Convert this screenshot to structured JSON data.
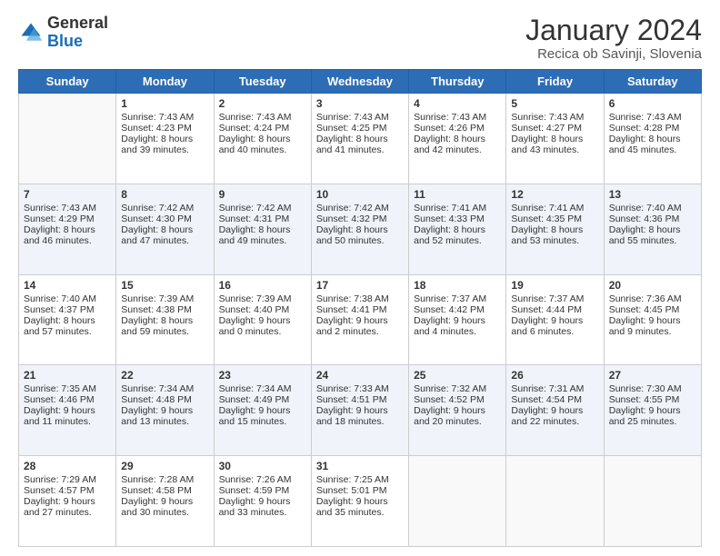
{
  "header": {
    "logo_line1": "General",
    "logo_line2": "Blue",
    "main_title": "January 2024",
    "subtitle": "Recica ob Savinji, Slovenia"
  },
  "days_of_week": [
    "Sunday",
    "Monday",
    "Tuesday",
    "Wednesday",
    "Thursday",
    "Friday",
    "Saturday"
  ],
  "weeks": [
    [
      {
        "day": "",
        "sunrise": "",
        "sunset": "",
        "daylight": ""
      },
      {
        "day": "1",
        "sunrise": "Sunrise: 7:43 AM",
        "sunset": "Sunset: 4:23 PM",
        "daylight": "Daylight: 8 hours and 39 minutes."
      },
      {
        "day": "2",
        "sunrise": "Sunrise: 7:43 AM",
        "sunset": "Sunset: 4:24 PM",
        "daylight": "Daylight: 8 hours and 40 minutes."
      },
      {
        "day": "3",
        "sunrise": "Sunrise: 7:43 AM",
        "sunset": "Sunset: 4:25 PM",
        "daylight": "Daylight: 8 hours and 41 minutes."
      },
      {
        "day": "4",
        "sunrise": "Sunrise: 7:43 AM",
        "sunset": "Sunset: 4:26 PM",
        "daylight": "Daylight: 8 hours and 42 minutes."
      },
      {
        "day": "5",
        "sunrise": "Sunrise: 7:43 AM",
        "sunset": "Sunset: 4:27 PM",
        "daylight": "Daylight: 8 hours and 43 minutes."
      },
      {
        "day": "6",
        "sunrise": "Sunrise: 7:43 AM",
        "sunset": "Sunset: 4:28 PM",
        "daylight": "Daylight: 8 hours and 45 minutes."
      }
    ],
    [
      {
        "day": "7",
        "sunrise": "Sunrise: 7:43 AM",
        "sunset": "Sunset: 4:29 PM",
        "daylight": "Daylight: 8 hours and 46 minutes."
      },
      {
        "day": "8",
        "sunrise": "Sunrise: 7:42 AM",
        "sunset": "Sunset: 4:30 PM",
        "daylight": "Daylight: 8 hours and 47 minutes."
      },
      {
        "day": "9",
        "sunrise": "Sunrise: 7:42 AM",
        "sunset": "Sunset: 4:31 PM",
        "daylight": "Daylight: 8 hours and 49 minutes."
      },
      {
        "day": "10",
        "sunrise": "Sunrise: 7:42 AM",
        "sunset": "Sunset: 4:32 PM",
        "daylight": "Daylight: 8 hours and 50 minutes."
      },
      {
        "day": "11",
        "sunrise": "Sunrise: 7:41 AM",
        "sunset": "Sunset: 4:33 PM",
        "daylight": "Daylight: 8 hours and 52 minutes."
      },
      {
        "day": "12",
        "sunrise": "Sunrise: 7:41 AM",
        "sunset": "Sunset: 4:35 PM",
        "daylight": "Daylight: 8 hours and 53 minutes."
      },
      {
        "day": "13",
        "sunrise": "Sunrise: 7:40 AM",
        "sunset": "Sunset: 4:36 PM",
        "daylight": "Daylight: 8 hours and 55 minutes."
      }
    ],
    [
      {
        "day": "14",
        "sunrise": "Sunrise: 7:40 AM",
        "sunset": "Sunset: 4:37 PM",
        "daylight": "Daylight: 8 hours and 57 minutes."
      },
      {
        "day": "15",
        "sunrise": "Sunrise: 7:39 AM",
        "sunset": "Sunset: 4:38 PM",
        "daylight": "Daylight: 8 hours and 59 minutes."
      },
      {
        "day": "16",
        "sunrise": "Sunrise: 7:39 AM",
        "sunset": "Sunset: 4:40 PM",
        "daylight": "Daylight: 9 hours and 0 minutes."
      },
      {
        "day": "17",
        "sunrise": "Sunrise: 7:38 AM",
        "sunset": "Sunset: 4:41 PM",
        "daylight": "Daylight: 9 hours and 2 minutes."
      },
      {
        "day": "18",
        "sunrise": "Sunrise: 7:37 AM",
        "sunset": "Sunset: 4:42 PM",
        "daylight": "Daylight: 9 hours and 4 minutes."
      },
      {
        "day": "19",
        "sunrise": "Sunrise: 7:37 AM",
        "sunset": "Sunset: 4:44 PM",
        "daylight": "Daylight: 9 hours and 6 minutes."
      },
      {
        "day": "20",
        "sunrise": "Sunrise: 7:36 AM",
        "sunset": "Sunset: 4:45 PM",
        "daylight": "Daylight: 9 hours and 9 minutes."
      }
    ],
    [
      {
        "day": "21",
        "sunrise": "Sunrise: 7:35 AM",
        "sunset": "Sunset: 4:46 PM",
        "daylight": "Daylight: 9 hours and 11 minutes."
      },
      {
        "day": "22",
        "sunrise": "Sunrise: 7:34 AM",
        "sunset": "Sunset: 4:48 PM",
        "daylight": "Daylight: 9 hours and 13 minutes."
      },
      {
        "day": "23",
        "sunrise": "Sunrise: 7:34 AM",
        "sunset": "Sunset: 4:49 PM",
        "daylight": "Daylight: 9 hours and 15 minutes."
      },
      {
        "day": "24",
        "sunrise": "Sunrise: 7:33 AM",
        "sunset": "Sunset: 4:51 PM",
        "daylight": "Daylight: 9 hours and 18 minutes."
      },
      {
        "day": "25",
        "sunrise": "Sunrise: 7:32 AM",
        "sunset": "Sunset: 4:52 PM",
        "daylight": "Daylight: 9 hours and 20 minutes."
      },
      {
        "day": "26",
        "sunrise": "Sunrise: 7:31 AM",
        "sunset": "Sunset: 4:54 PM",
        "daylight": "Daylight: 9 hours and 22 minutes."
      },
      {
        "day": "27",
        "sunrise": "Sunrise: 7:30 AM",
        "sunset": "Sunset: 4:55 PM",
        "daylight": "Daylight: 9 hours and 25 minutes."
      }
    ],
    [
      {
        "day": "28",
        "sunrise": "Sunrise: 7:29 AM",
        "sunset": "Sunset: 4:57 PM",
        "daylight": "Daylight: 9 hours and 27 minutes."
      },
      {
        "day": "29",
        "sunrise": "Sunrise: 7:28 AM",
        "sunset": "Sunset: 4:58 PM",
        "daylight": "Daylight: 9 hours and 30 minutes."
      },
      {
        "day": "30",
        "sunrise": "Sunrise: 7:26 AM",
        "sunset": "Sunset: 4:59 PM",
        "daylight": "Daylight: 9 hours and 33 minutes."
      },
      {
        "day": "31",
        "sunrise": "Sunrise: 7:25 AM",
        "sunset": "Sunset: 5:01 PM",
        "daylight": "Daylight: 9 hours and 35 minutes."
      },
      {
        "day": "",
        "sunrise": "",
        "sunset": "",
        "daylight": ""
      },
      {
        "day": "",
        "sunrise": "",
        "sunset": "",
        "daylight": ""
      },
      {
        "day": "",
        "sunrise": "",
        "sunset": "",
        "daylight": ""
      }
    ]
  ]
}
